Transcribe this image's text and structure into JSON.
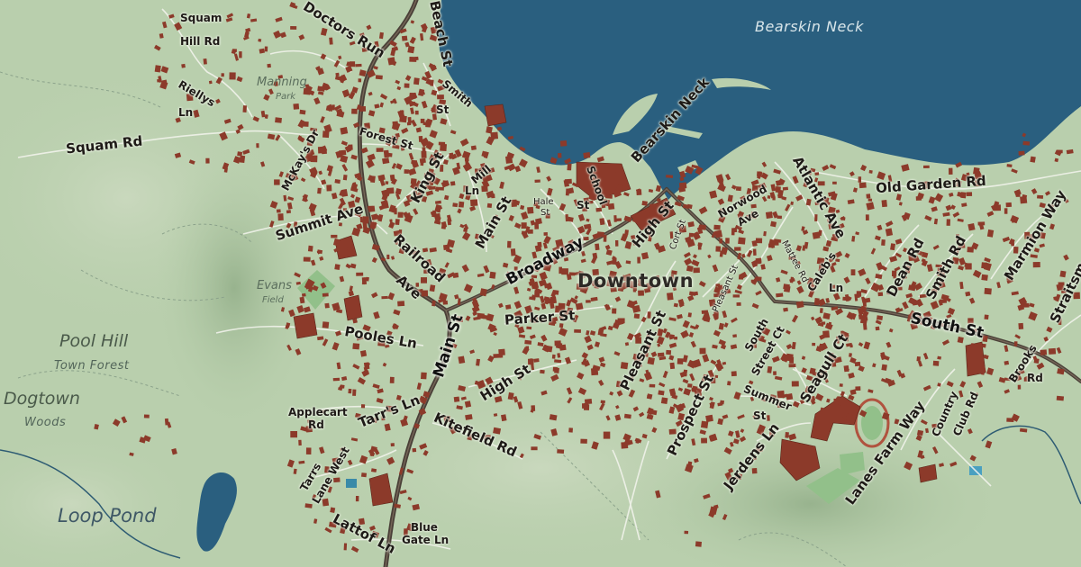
{
  "map": {
    "colors": {
      "sea": "#2a5f7f",
      "land": "#b9cfad",
      "buildings": "#8c3a2a",
      "main_road": "#4a4038",
      "park": "#92c08a",
      "track": "#b0533f"
    },
    "water_labels": {
      "harbor": "Bearskin Neck",
      "pond": "Loop Pond"
    },
    "place_labels": {
      "downtown": "Downtown",
      "manning": "Manning",
      "manning_sub": "Park",
      "evans": "Evans",
      "evans_sub": "Field",
      "pool_hill": "Pool Hill",
      "pool_hill_sub": "Town Forest",
      "dogtown": "Dogtown",
      "dogtown_sub": "Woods"
    },
    "streets": {
      "squam_hill_rd_1": "Squam",
      "squam_hill_rd_2": "Hill Rd",
      "doctors_run": "Doctors Run",
      "beach_st": "Beach St",
      "riellys_1": "Riellys",
      "riellys_2": "Ln",
      "squam_rd": "Squam Rd",
      "mckays_dr": "McKay's Dr",
      "summit_ave": "Summit Ave",
      "forest_st": "Forest St",
      "smith_st_1": "Smith",
      "smith_st_2": "St",
      "king_st": "King St",
      "mill_ln_1": "Mill",
      "mill_ln_2": "Ln",
      "main_st_north": "Main St",
      "hale_st_1": "Hale",
      "hale_st_2": "St",
      "school_st_1": "School",
      "school_st_2": "St",
      "bearskin_neck": "Bearskin Neck",
      "railroad_ave_1": "Railroad",
      "railroad_ave_2": "Ave",
      "broadway": "Broadway",
      "high_st_east": "High St",
      "cort_st": "Cort St",
      "norwood_ave_1": "Norwood",
      "norwood_ave_2": "Ave",
      "atlantic_ave": "Atlantic Ave",
      "old_garden_rd": "Old Garden Rd",
      "marmion_way": "Marmion Way",
      "dean_rd": "Dean Rd",
      "smith_rd": "Smith Rd",
      "straitsmouth": "Straitsm",
      "mt_pleasant_st": "Pleasant St",
      "pleasant_st": "Pleasant St",
      "mattee_rd": "Mattee Rd",
      "calebs_ln_1": "Caleb's",
      "calebs_ln_2": "Ln",
      "south_st": "South St",
      "pooles_ln": "Pooles Ln",
      "parker_st": "Parker St",
      "main_st_south": "Main St",
      "high_st_west": "High St",
      "south_street_ct_1": "South",
      "south_street_ct_2": "Street Ct",
      "seagull_ct": "Seagull Ct",
      "brooks_rd_1": "Brooks",
      "brooks_rd_2": "Rd",
      "country_club_rd_1": "Country",
      "country_club_rd_2": "Club Rd",
      "summer_st_1": "Summer",
      "summer_st_2": "St",
      "prospect_st": "Prospect St",
      "lanes_farm_way": "Lanes Farm Way",
      "jerdens_ln": "Jerdens Ln",
      "applecart_rd_1": "Applecart",
      "applecart_rd_2": "Rd",
      "tarrs_ln": "Tarr's Ln",
      "kitefield_rd": "Kitefield Rd",
      "tarrs_lane_west_1": "Tarrs",
      "tarrs_lane_west_2": "Lane West",
      "blue_gate_ln_1": "Blue",
      "blue_gate_ln_2": "Gate Ln",
      "lattof_ln": "Lattof Ln"
    }
  }
}
